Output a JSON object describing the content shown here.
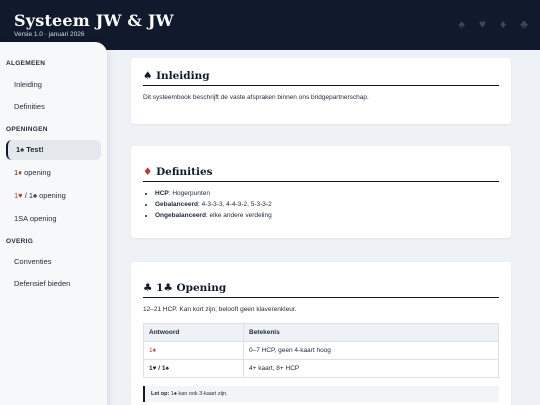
{
  "header": {
    "title": "Systeem JW & JW",
    "subtitle": "Versie 1.0 · januari 2026",
    "suits": [
      "♠",
      "♥",
      "♦",
      "♣"
    ]
  },
  "sidebar": {
    "groups": [
      "ALGEMEEN",
      "OPENINGEN",
      "OVERIG"
    ],
    "items": [
      {
        "label": "Inleiding"
      },
      {
        "label": "Definities"
      },
      {
        "label": "1♠ Test!",
        "suit": "♠",
        "rest": " Test!"
      },
      {
        "label": "1♦ opening",
        "suit": "♦",
        "rest": " opening"
      },
      {
        "label": "1♥ / 1♠ opening",
        "a": "1♥",
        "sep": " / ",
        "b": "1♠",
        "rest": " opening"
      },
      {
        "label": "1SA opening"
      },
      {
        "label": "Conventies"
      },
      {
        "label": "Defensief bieden"
      }
    ]
  },
  "sections": {
    "intro": {
      "suit": "♠",
      "title": "Inleiding",
      "text": "Dit systeembook beschrijft de vaste afspraken binnen ons bridgepartnerschap."
    },
    "defs": {
      "suit": "♦",
      "title": "Definities",
      "items": [
        {
          "term": "HCP",
          "desc": ": Hogerpunten"
        },
        {
          "term": "Gebalanceerd",
          "desc": ": 4-3-3-3, 4-4-3-2, 5-3-3-2"
        },
        {
          "term": "Ongebalanceerd",
          "desc": ": elke andere verdeling"
        }
      ]
    },
    "opening": {
      "suit": "♣",
      "title": "1♣ Opening",
      "text": "12–21 HCP. Kan kort zijn; belooft geen klaverenkleur.",
      "col1": "Antwoord",
      "col2": "Betekenis",
      "rows": [
        {
          "a": "1♦",
          "b": "0–7 HCP, geen 4-kaart hoog"
        },
        {
          "a": "1♥ / 1♠",
          "b": "4+ kaart, 8+ HCP"
        }
      ],
      "note_label": "Let op:",
      "note_text": " 1♠ kan ook 3-kaart zijn."
    }
  }
}
